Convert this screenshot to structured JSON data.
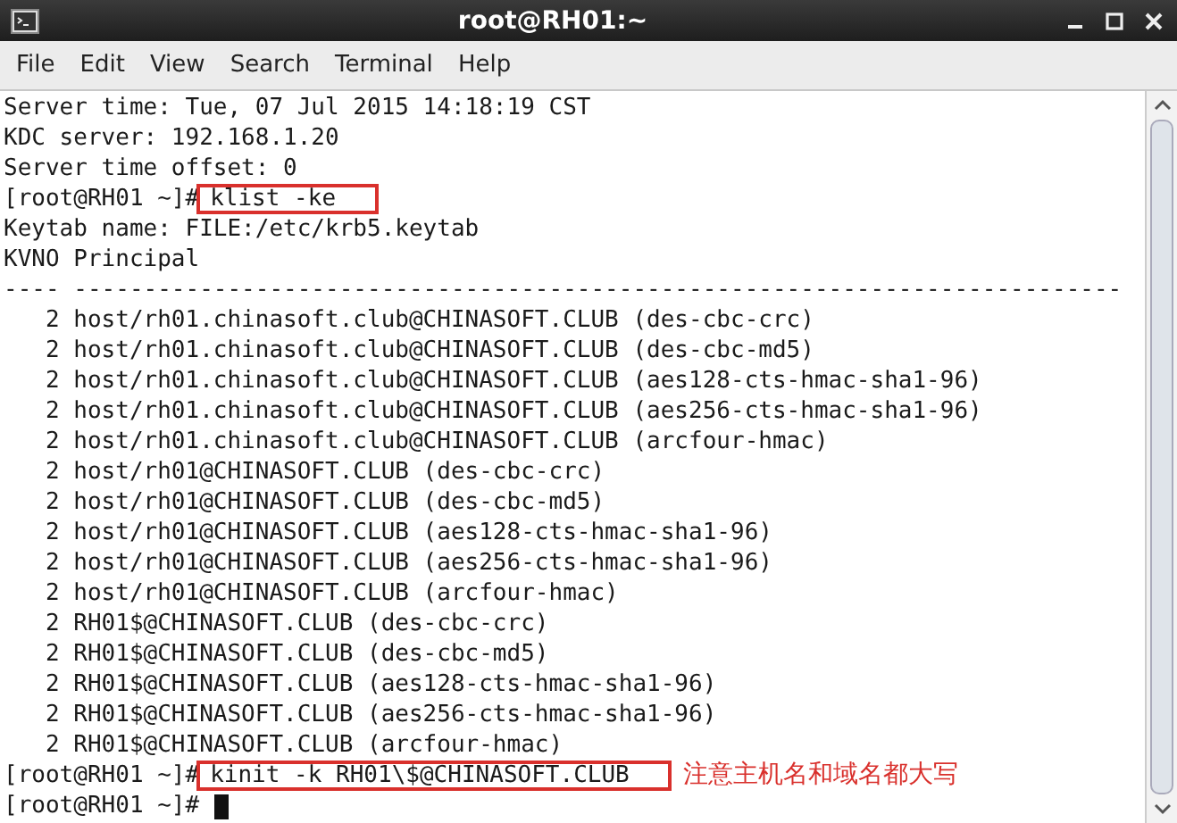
{
  "window": {
    "title": "root@RH01:~"
  },
  "menu": [
    "File",
    "Edit",
    "View",
    "Search",
    "Terminal",
    "Help"
  ],
  "terminal": {
    "lines": [
      {
        "kind": "output",
        "text": "Server time: Tue, 07 Jul 2015 14:18:19 CST"
      },
      {
        "kind": "output",
        "text": "KDC server: 192.168.1.20"
      },
      {
        "kind": "output",
        "text": "Server time offset: 0"
      },
      {
        "kind": "prompt",
        "prompt": "[root@RH01 ~]#",
        "command": "klist -ke",
        "highlighted": true
      },
      {
        "kind": "output",
        "text": "Keytab name: FILE:/etc/krb5.keytab"
      },
      {
        "kind": "output",
        "text": "KVNO Principal"
      },
      {
        "kind": "output",
        "text": "---- ---------------------------------------------------------------------------"
      },
      {
        "kind": "output",
        "text": "   2 host/rh01.chinasoft.club@CHINASOFT.CLUB (des-cbc-crc)"
      },
      {
        "kind": "output",
        "text": "   2 host/rh01.chinasoft.club@CHINASOFT.CLUB (des-cbc-md5)"
      },
      {
        "kind": "output",
        "text": "   2 host/rh01.chinasoft.club@CHINASOFT.CLUB (aes128-cts-hmac-sha1-96)"
      },
      {
        "kind": "output",
        "text": "   2 host/rh01.chinasoft.club@CHINASOFT.CLUB (aes256-cts-hmac-sha1-96)"
      },
      {
        "kind": "output",
        "text": "   2 host/rh01.chinasoft.club@CHINASOFT.CLUB (arcfour-hmac)"
      },
      {
        "kind": "output",
        "text": "   2 host/rh01@CHINASOFT.CLUB (des-cbc-crc)"
      },
      {
        "kind": "output",
        "text": "   2 host/rh01@CHINASOFT.CLUB (des-cbc-md5)"
      },
      {
        "kind": "output",
        "text": "   2 host/rh01@CHINASOFT.CLUB (aes128-cts-hmac-sha1-96)"
      },
      {
        "kind": "output",
        "text": "   2 host/rh01@CHINASOFT.CLUB (aes256-cts-hmac-sha1-96)"
      },
      {
        "kind": "output",
        "text": "   2 host/rh01@CHINASOFT.CLUB (arcfour-hmac)"
      },
      {
        "kind": "output",
        "text": "   2 RH01$@CHINASOFT.CLUB (des-cbc-crc)"
      },
      {
        "kind": "output",
        "text": "   2 RH01$@CHINASOFT.CLUB (des-cbc-md5)"
      },
      {
        "kind": "output",
        "text": "   2 RH01$@CHINASOFT.CLUB (aes128-cts-hmac-sha1-96)"
      },
      {
        "kind": "output",
        "text": "   2 RH01$@CHINASOFT.CLUB (aes256-cts-hmac-sha1-96)"
      },
      {
        "kind": "output",
        "text": "   2 RH01$@CHINASOFT.CLUB (arcfour-hmac)"
      },
      {
        "kind": "prompt",
        "prompt": "[root@RH01 ~]#",
        "command": "kinit -k RH01\\$@CHINASOFT.CLUB",
        "highlighted": true,
        "note": "注意主机名和域名都大写"
      },
      {
        "kind": "prompt",
        "prompt": "[root@RH01 ~]#",
        "cursor": true
      }
    ]
  }
}
